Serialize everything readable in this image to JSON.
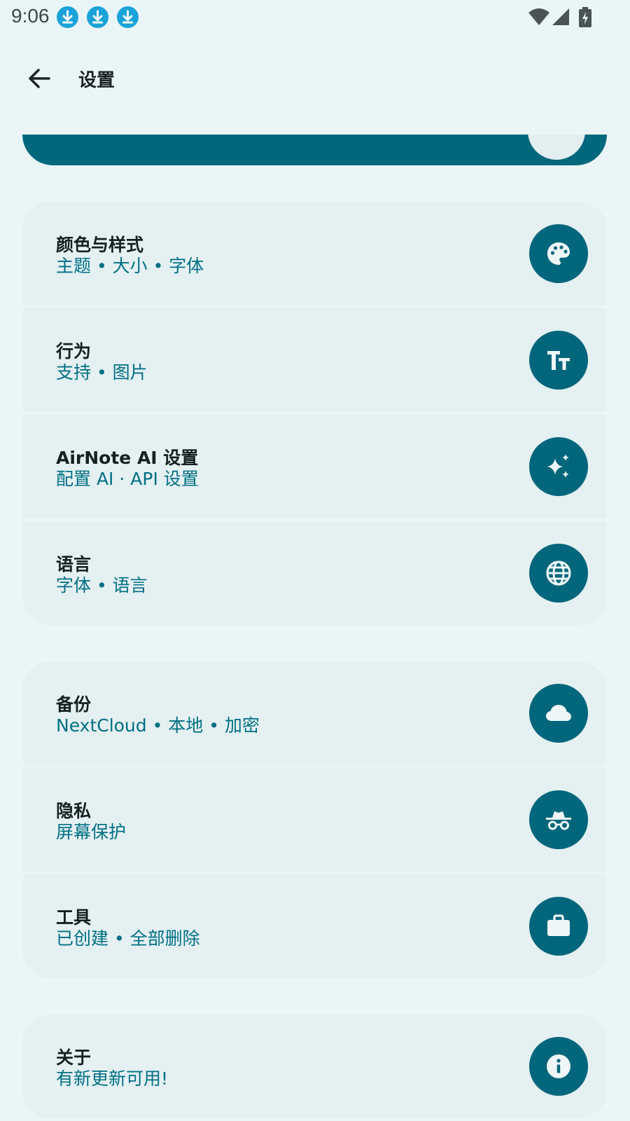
{
  "status_bar": {
    "time": "9:06",
    "notifications": [
      "download-icon",
      "download-icon",
      "download-icon"
    ],
    "system_icons": [
      "wifi-icon",
      "signal-icon",
      "battery-charging-icon"
    ]
  },
  "app_bar": {
    "back_icon": "arrow-back-icon",
    "title": "设置"
  },
  "groups": [
    {
      "items": [
        {
          "id": "appearance",
          "label": "颜色与样式",
          "subtitle": "主题 • 大小 • 字体",
          "icon": "palette-icon"
        },
        {
          "id": "behavior",
          "label": "行为",
          "subtitle": "支持 • 图片",
          "icon": "text-size-icon"
        },
        {
          "id": "ai",
          "label": "AirNote AI 设置",
          "subtitle": "配置 AI · API 设置",
          "icon": "sparkle-icon"
        },
        {
          "id": "language",
          "label": "语言",
          "subtitle": "字体 • 语言",
          "icon": "globe-icon"
        }
      ]
    },
    {
      "items": [
        {
          "id": "backup",
          "label": "备份",
          "subtitle": "NextCloud • 本地 • 加密",
          "icon": "cloud-icon"
        },
        {
          "id": "privacy",
          "label": "隐私",
          "subtitle": "屏幕保护",
          "icon": "incognito-icon"
        },
        {
          "id": "tools",
          "label": "工具",
          "subtitle": "已创建 • 全部删除",
          "icon": "briefcase-icon"
        }
      ]
    },
    {
      "items": [
        {
          "id": "about",
          "label": "关于",
          "subtitle": "有新更新可用!",
          "icon": "info-icon"
        }
      ]
    }
  ],
  "colors": {
    "background": "#eaf5f7",
    "card": "#e4f0f2",
    "accent": "#00667b",
    "subtitle": "#006f84",
    "title_text": "#142022"
  }
}
